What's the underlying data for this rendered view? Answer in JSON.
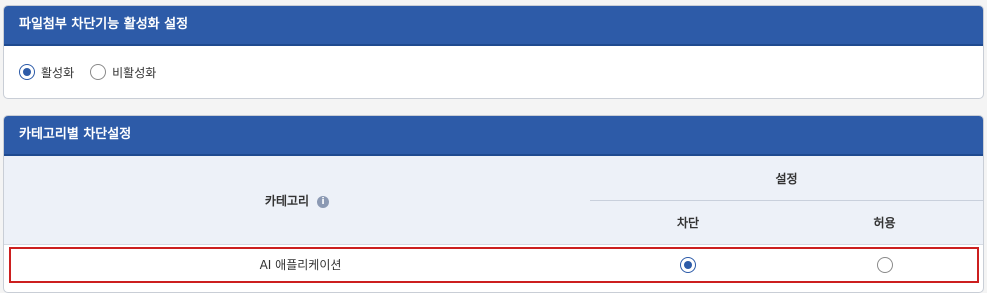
{
  "file_block": {
    "title": "파일첨부 차단기능 활성화 설정",
    "options": [
      {
        "label": "활성화",
        "selected": true
      },
      {
        "label": "비활성화",
        "selected": false
      }
    ]
  },
  "category_block": {
    "title": "카테고리별 차단설정",
    "headers": {
      "category": "카테고리",
      "setting": "설정",
      "block": "차단",
      "allow": "허용"
    },
    "info_icon": "i",
    "rows": [
      {
        "category": "AI 애플리케이션",
        "selected": "block"
      }
    ]
  }
}
